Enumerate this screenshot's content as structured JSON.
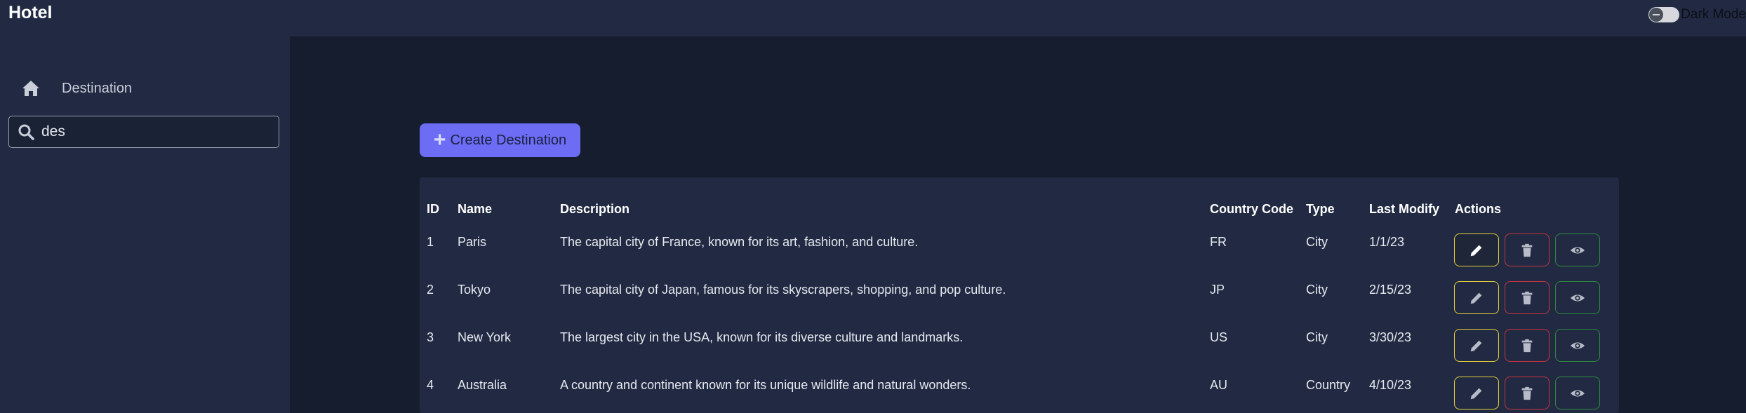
{
  "app": {
    "title": "Hotel"
  },
  "dark_mode": {
    "label": "Dark Mode",
    "enabled": false
  },
  "sidebar": {
    "items": [
      {
        "label": "Destination",
        "icon": "home-icon"
      }
    ],
    "search": {
      "value": "des",
      "icon": "search-icon"
    }
  },
  "main": {
    "create_button": {
      "label": "Create Destination",
      "icon": "plus-icon"
    },
    "table": {
      "headers": [
        "ID",
        "Name",
        "Description",
        "Country Code",
        "Type",
        "Last Modify",
        "Actions"
      ],
      "rows": [
        {
          "id": "1",
          "name": "Paris",
          "description": "The capital city of France, known for its art, fashion, and culture.",
          "country_code": "FR",
          "type": "City",
          "last_modify": "1/1/23"
        },
        {
          "id": "2",
          "name": "Tokyo",
          "description": "The capital city of Japan, famous for its skyscrapers, shopping, and pop culture.",
          "country_code": "JP",
          "type": "City",
          "last_modify": "2/15/23"
        },
        {
          "id": "3",
          "name": "New York",
          "description": "The largest city in the USA, known for its diverse culture and landmarks.",
          "country_code": "US",
          "type": "City",
          "last_modify": "3/30/23"
        },
        {
          "id": "4",
          "name": "Australia",
          "description": "A country and continent known for its unique wildlife and natural wonders.",
          "country_code": "AU",
          "type": "Country",
          "last_modify": "4/10/23"
        }
      ],
      "actions": {
        "edit_icon": "pencil-icon",
        "delete_icon": "trash-icon",
        "view_icon": "eye-icon"
      }
    }
  },
  "colors": {
    "topbar": "#212a42",
    "sidebar": "#212a42",
    "content_bg": "#161d2e",
    "accent": "#6c6cf5",
    "edit_border": "#e6d23a",
    "delete_border": "#c8343f",
    "view_border": "#2e8a3e"
  }
}
